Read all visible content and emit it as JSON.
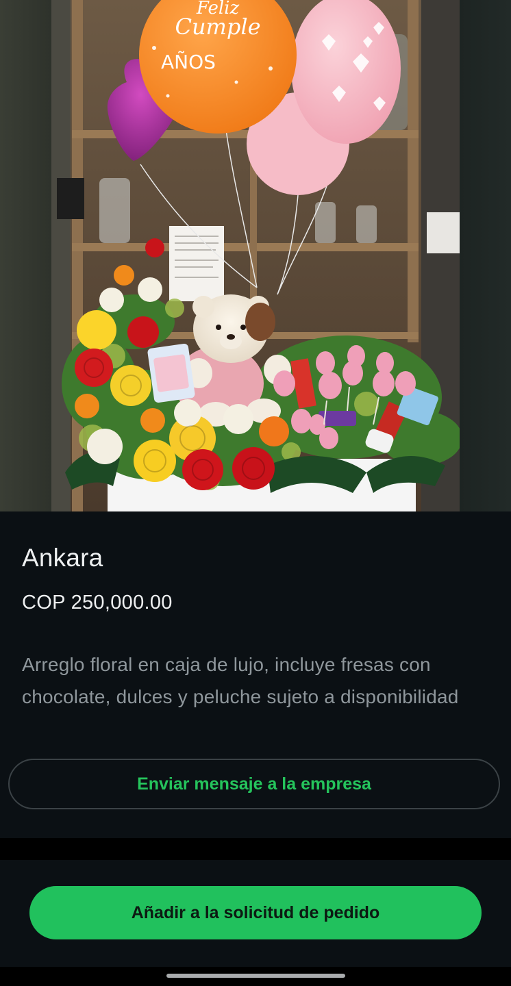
{
  "product": {
    "image_alt": "Arreglo floral con rosas, globos, peluche y fresas con chocolate",
    "name": "Ankara",
    "price": "COP 250,000.00",
    "description": "Arreglo floral en caja de lujo, incluye fresas con chocolate, dulces y peluche sujeto a disponibilidad"
  },
  "actions": {
    "message_label": "Enviar mensaje a la empresa",
    "add_to_order_label": "Añadir a la solicitud de pedido"
  },
  "balloons": {
    "orange_text_line1": "Feliz",
    "orange_text_line2": "Cumple",
    "orange_text_line3": "AÑOS"
  },
  "colors": {
    "accent_green": "#21c15d",
    "background": "#0b1014",
    "text_primary": "#eef0f1",
    "text_secondary": "#8f979c"
  }
}
